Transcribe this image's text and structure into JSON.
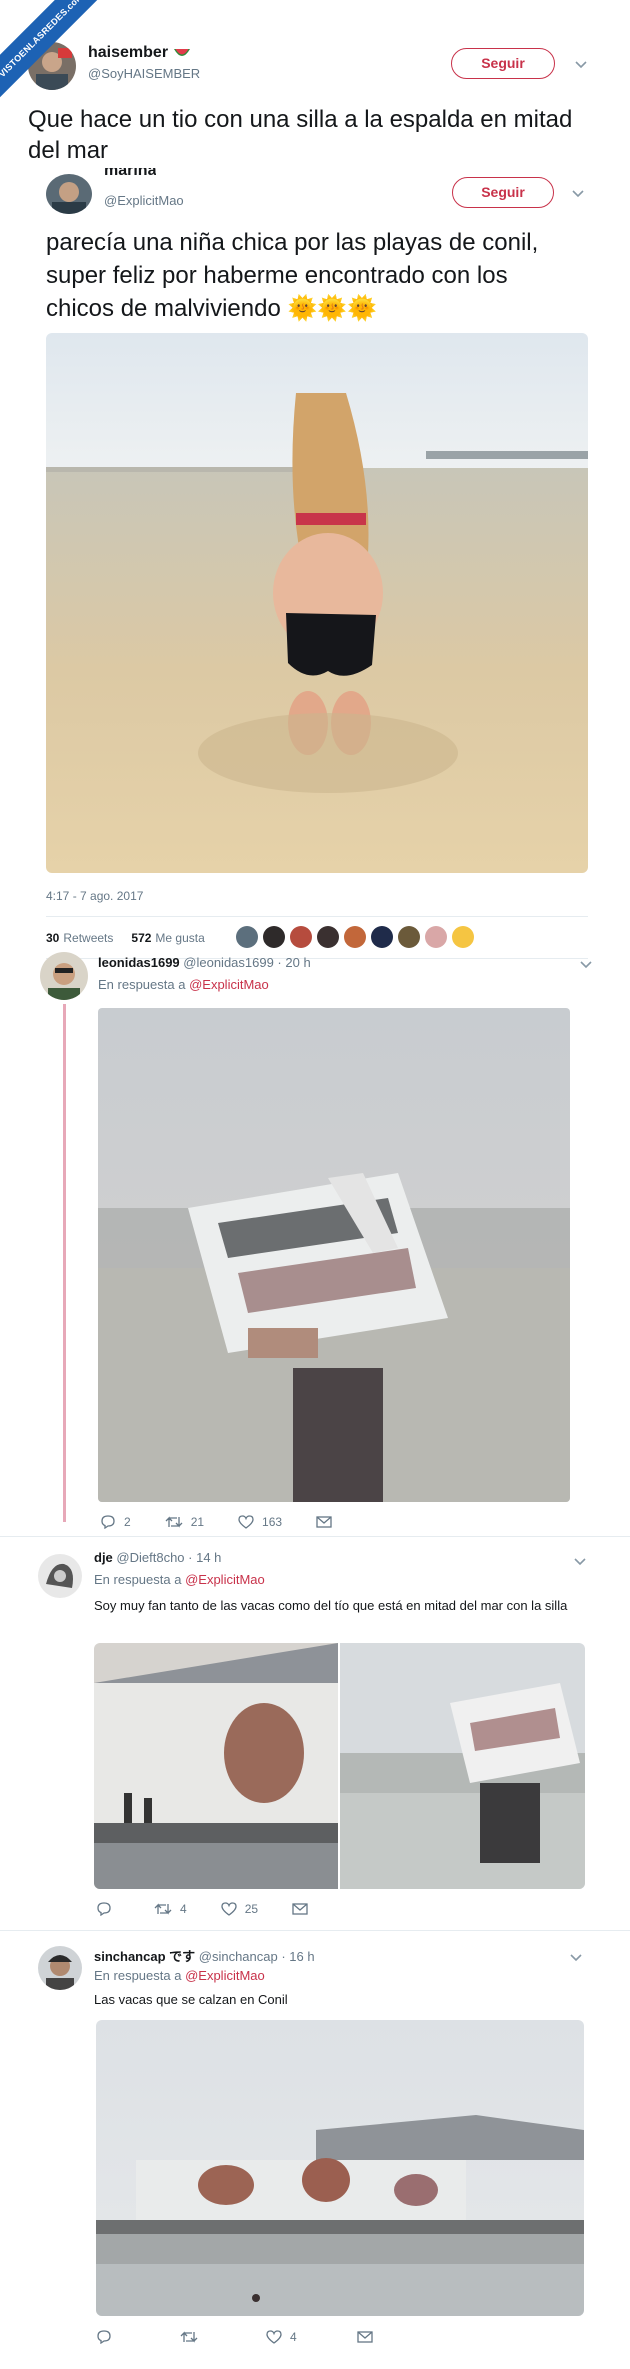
{
  "watermark": "VISTOENLASREDES.com",
  "main": {
    "name": "haisember",
    "handle": "@SoyHAISEMBER",
    "follow_label": "Seguir",
    "text": "Que hace un tio con una silla a la espalda en mitad del mar"
  },
  "quoted": {
    "name": "marina",
    "handle": "@ExplicitMao",
    "follow_label": "Seguir",
    "text": "parecía una niña chica por las playas de conil, super feliz por haberme encontrado con los chicos de malviviendo 🌞🌞🌞",
    "timestamp": "4:17 - 7 ago. 2017",
    "retweets": "30",
    "retweets_label": "Retweets",
    "likes": "572",
    "likes_label": "Me gusta"
  },
  "replies": [
    {
      "name": "leonidas1699",
      "meta": "@leonidas1699 · 20 h",
      "in_reply_prefix": "En respuesta a",
      "in_reply_handle": "@ExplicitMao",
      "text": "",
      "reply_count": "2",
      "rt_count": "21",
      "like_count": "163"
    },
    {
      "name": "dje",
      "meta": "@Dieft8cho · 14 h",
      "in_reply_prefix": "En respuesta a",
      "in_reply_handle": "@ExplicitMao",
      "text": "Soy muy fan tanto de las vacas como del tío que está en mitad del mar con la silla",
      "reply_count": "",
      "rt_count": "4",
      "like_count": "25"
    },
    {
      "name": "sinchancap です",
      "meta": "@sinchancap · 16 h",
      "in_reply_prefix": "En respuesta a",
      "in_reply_handle": "@ExplicitMao",
      "text": "Las vacas que se calzan en Conil",
      "reply_count": "",
      "rt_count": "",
      "like_count": "4"
    }
  ],
  "icons": {
    "reply": "reply-icon",
    "retweet": "retweet-icon",
    "like": "heart-icon",
    "dm": "mail-icon",
    "chevron": "chevron-down-icon"
  }
}
